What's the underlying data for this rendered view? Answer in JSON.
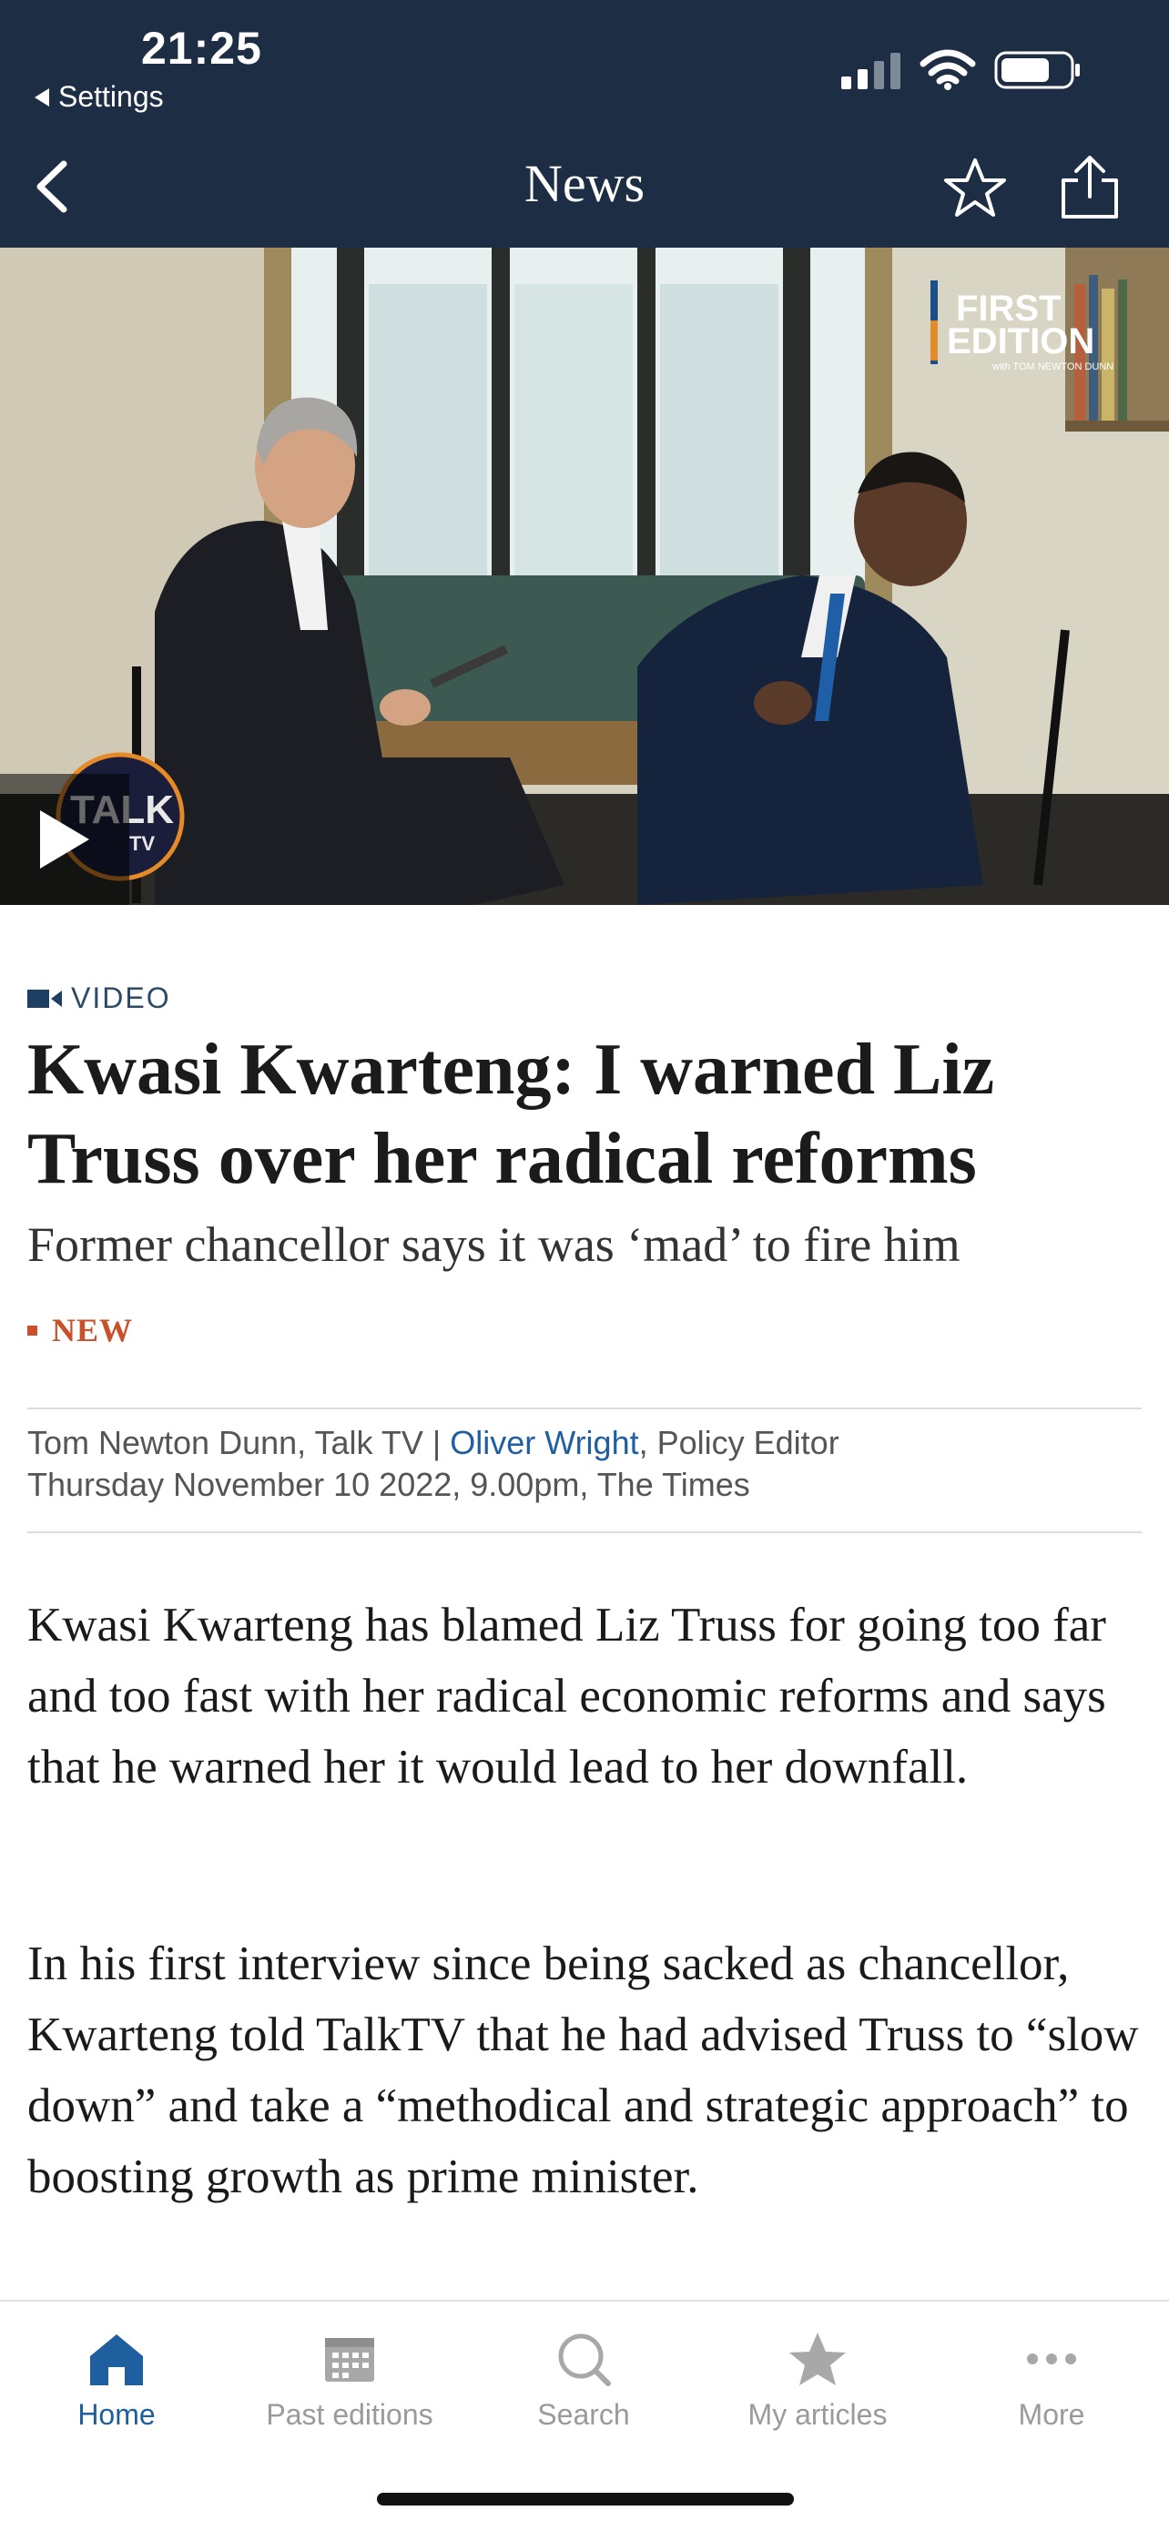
{
  "status_bar": {
    "time": "21:25",
    "back_app": "Settings"
  },
  "nav": {
    "title": "News"
  },
  "hero": {
    "overlay_brand": "FIRST",
    "overlay_brand_2": "EDITION",
    "overlay_sub": "with TOM NEWTON DUNN",
    "logo_text": "TALK",
    "logo_sub": "TV"
  },
  "article": {
    "label": "VIDEO",
    "headline": "Kwasi Kwarteng: I warned Liz Truss over her radical reforms",
    "standfirst": "Former chancellor says it was ‘mad’ to fire him",
    "tag": "NEW",
    "byline_author_1": "Tom Newton Dunn, Talk TV | ",
    "byline_author_2": "Oliver Wright",
    "byline_author_2_role": ", Policy Editor",
    "byline_date": "Thursday November 10 2022, 9.00pm, The Times",
    "paragraphs": [
      "Kwasi Kwarteng has blamed Liz Truss for going too far and too fast with her radical economic reforms and says that he warned her it would lead to her downfall.",
      "In his first interview since being sacked as chancellor, Kwarteng told TalkTV that he had advised Truss to “slow down” and take a “methodical and strategic approach” to boosting growth as prime minister."
    ]
  },
  "tabbar": {
    "items": [
      {
        "label": "Home",
        "icon": "home-icon",
        "active": true
      },
      {
        "label": "Past editions",
        "icon": "calendar-icon",
        "active": false
      },
      {
        "label": "Search",
        "icon": "search-icon",
        "active": false
      },
      {
        "label": "My articles",
        "icon": "star-icon",
        "active": false
      },
      {
        "label": "More",
        "icon": "more-icon",
        "active": false
      }
    ]
  },
  "colors": {
    "header": "#1d2d44",
    "link": "#1f5fa0",
    "accent": "#c8502a",
    "inactive": "#9a9a9a"
  }
}
